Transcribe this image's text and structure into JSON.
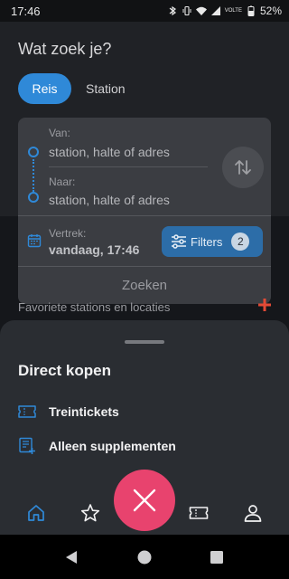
{
  "status_bar": {
    "time": "17:46",
    "network_label": "VOLTE",
    "battery": "52%"
  },
  "search": {
    "heading": "Wat zoek je?",
    "tabs": [
      {
        "label": "Reis",
        "active": true
      },
      {
        "label": "Station",
        "active": false
      }
    ],
    "from_label": "Van:",
    "from_placeholder": "station, halte of adres",
    "to_label": "Naar:",
    "to_placeholder": "station, halte of adres",
    "departure_label": "Vertrek:",
    "departure_value": "vandaag, 17:46",
    "filters_label": "Filters",
    "filters_count": "2",
    "submit_label": "Zoeken"
  },
  "favorites": {
    "title": "Favoriete stations en locaties"
  },
  "sheet": {
    "title": "Direct kopen",
    "items": [
      {
        "label": "Treintickets",
        "icon": "ticket-icon"
      },
      {
        "label": "Alleen supplementen",
        "icon": "supplement-list-icon"
      }
    ]
  },
  "bottom_nav": {
    "items": [
      "home-icon",
      "star-icon",
      "close-icon",
      "ticket-icon",
      "profile-icon"
    ]
  },
  "colors": {
    "accent": "#2f89d8",
    "fab": "#e8436e",
    "favorites_plus": "#e24a36"
  }
}
